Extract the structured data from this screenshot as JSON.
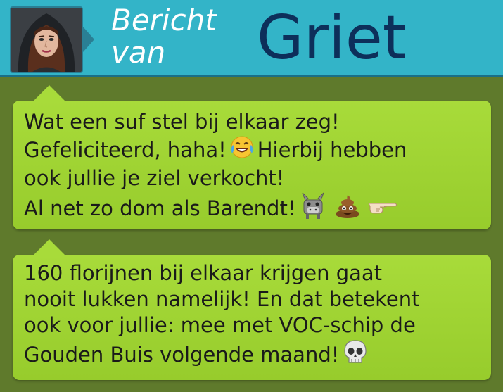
{
  "header": {
    "label_line1": "Bericht",
    "label_line2": "van",
    "sender": "Griet",
    "avatar_icon": "avatar-woman-hooded"
  },
  "messages": [
    {
      "lines": [
        "Wat een suf stel bij elkaar zeg!",
        "Gefeliciteerd, haha!",
        "Hierbij hebben",
        "ook jullie je ziel verkocht!",
        "Al net zo dom als Barendt!"
      ],
      "emojis": [
        "laughing-tears-icon",
        "donkey-icon",
        "poop-icon",
        "pointing-hand-icon"
      ]
    },
    {
      "lines": [
        "160 florijnen bij elkaar krijgen gaat",
        "nooit lukken namelijk! En dat betekent",
        "ook voor jullie: mee met VOC-schip de",
        "Gouden Buis volgende maand!"
      ],
      "emojis": [
        "skull-icon"
      ]
    }
  ],
  "colors": {
    "background": "#5f7a2c",
    "header": "#33b4c8",
    "bubble": "#a8db3a",
    "sender": "#0d2f5a"
  }
}
